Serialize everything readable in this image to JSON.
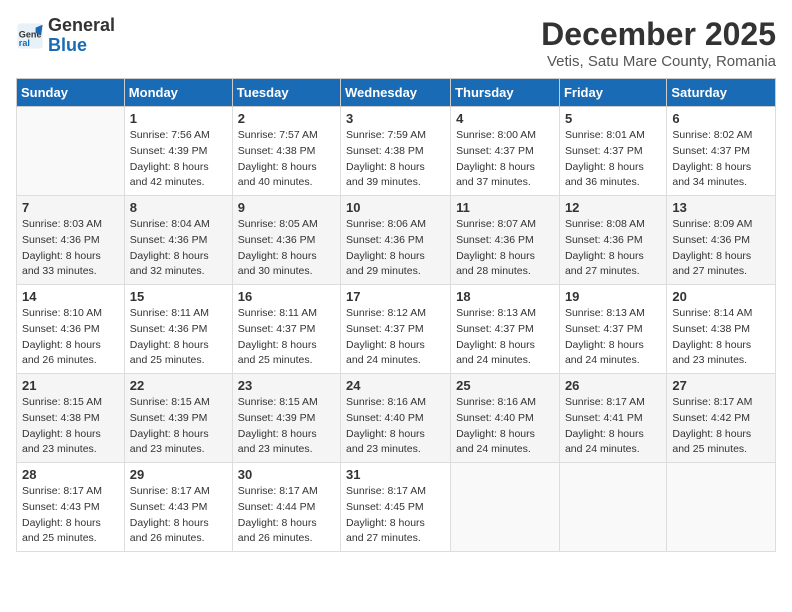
{
  "header": {
    "logo_line1": "General",
    "logo_line2": "Blue",
    "title": "December 2025",
    "subtitle": "Vetis, Satu Mare County, Romania"
  },
  "columns": [
    "Sunday",
    "Monday",
    "Tuesday",
    "Wednesday",
    "Thursday",
    "Friday",
    "Saturday"
  ],
  "weeks": [
    [
      {
        "day": "",
        "info": ""
      },
      {
        "day": "1",
        "info": "Sunrise: 7:56 AM\nSunset: 4:39 PM\nDaylight: 8 hours\nand 42 minutes."
      },
      {
        "day": "2",
        "info": "Sunrise: 7:57 AM\nSunset: 4:38 PM\nDaylight: 8 hours\nand 40 minutes."
      },
      {
        "day": "3",
        "info": "Sunrise: 7:59 AM\nSunset: 4:38 PM\nDaylight: 8 hours\nand 39 minutes."
      },
      {
        "day": "4",
        "info": "Sunrise: 8:00 AM\nSunset: 4:37 PM\nDaylight: 8 hours\nand 37 minutes."
      },
      {
        "day": "5",
        "info": "Sunrise: 8:01 AM\nSunset: 4:37 PM\nDaylight: 8 hours\nand 36 minutes."
      },
      {
        "day": "6",
        "info": "Sunrise: 8:02 AM\nSunset: 4:37 PM\nDaylight: 8 hours\nand 34 minutes."
      }
    ],
    [
      {
        "day": "7",
        "info": "Sunrise: 8:03 AM\nSunset: 4:36 PM\nDaylight: 8 hours\nand 33 minutes."
      },
      {
        "day": "8",
        "info": "Sunrise: 8:04 AM\nSunset: 4:36 PM\nDaylight: 8 hours\nand 32 minutes."
      },
      {
        "day": "9",
        "info": "Sunrise: 8:05 AM\nSunset: 4:36 PM\nDaylight: 8 hours\nand 30 minutes."
      },
      {
        "day": "10",
        "info": "Sunrise: 8:06 AM\nSunset: 4:36 PM\nDaylight: 8 hours\nand 29 minutes."
      },
      {
        "day": "11",
        "info": "Sunrise: 8:07 AM\nSunset: 4:36 PM\nDaylight: 8 hours\nand 28 minutes."
      },
      {
        "day": "12",
        "info": "Sunrise: 8:08 AM\nSunset: 4:36 PM\nDaylight: 8 hours\nand 27 minutes."
      },
      {
        "day": "13",
        "info": "Sunrise: 8:09 AM\nSunset: 4:36 PM\nDaylight: 8 hours\nand 27 minutes."
      }
    ],
    [
      {
        "day": "14",
        "info": "Sunrise: 8:10 AM\nSunset: 4:36 PM\nDaylight: 8 hours\nand 26 minutes."
      },
      {
        "day": "15",
        "info": "Sunrise: 8:11 AM\nSunset: 4:36 PM\nDaylight: 8 hours\nand 25 minutes."
      },
      {
        "day": "16",
        "info": "Sunrise: 8:11 AM\nSunset: 4:37 PM\nDaylight: 8 hours\nand 25 minutes."
      },
      {
        "day": "17",
        "info": "Sunrise: 8:12 AM\nSunset: 4:37 PM\nDaylight: 8 hours\nand 24 minutes."
      },
      {
        "day": "18",
        "info": "Sunrise: 8:13 AM\nSunset: 4:37 PM\nDaylight: 8 hours\nand 24 minutes."
      },
      {
        "day": "19",
        "info": "Sunrise: 8:13 AM\nSunset: 4:37 PM\nDaylight: 8 hours\nand 24 minutes."
      },
      {
        "day": "20",
        "info": "Sunrise: 8:14 AM\nSunset: 4:38 PM\nDaylight: 8 hours\nand 23 minutes."
      }
    ],
    [
      {
        "day": "21",
        "info": "Sunrise: 8:15 AM\nSunset: 4:38 PM\nDaylight: 8 hours\nand 23 minutes."
      },
      {
        "day": "22",
        "info": "Sunrise: 8:15 AM\nSunset: 4:39 PM\nDaylight: 8 hours\nand 23 minutes."
      },
      {
        "day": "23",
        "info": "Sunrise: 8:15 AM\nSunset: 4:39 PM\nDaylight: 8 hours\nand 23 minutes."
      },
      {
        "day": "24",
        "info": "Sunrise: 8:16 AM\nSunset: 4:40 PM\nDaylight: 8 hours\nand 23 minutes."
      },
      {
        "day": "25",
        "info": "Sunrise: 8:16 AM\nSunset: 4:40 PM\nDaylight: 8 hours\nand 24 minutes."
      },
      {
        "day": "26",
        "info": "Sunrise: 8:17 AM\nSunset: 4:41 PM\nDaylight: 8 hours\nand 24 minutes."
      },
      {
        "day": "27",
        "info": "Sunrise: 8:17 AM\nSunset: 4:42 PM\nDaylight: 8 hours\nand 25 minutes."
      }
    ],
    [
      {
        "day": "28",
        "info": "Sunrise: 8:17 AM\nSunset: 4:43 PM\nDaylight: 8 hours\nand 25 minutes."
      },
      {
        "day": "29",
        "info": "Sunrise: 8:17 AM\nSunset: 4:43 PM\nDaylight: 8 hours\nand 26 minutes."
      },
      {
        "day": "30",
        "info": "Sunrise: 8:17 AM\nSunset: 4:44 PM\nDaylight: 8 hours\nand 26 minutes."
      },
      {
        "day": "31",
        "info": "Sunrise: 8:17 AM\nSunset: 4:45 PM\nDaylight: 8 hours\nand 27 minutes."
      },
      {
        "day": "",
        "info": ""
      },
      {
        "day": "",
        "info": ""
      },
      {
        "day": "",
        "info": ""
      }
    ]
  ]
}
